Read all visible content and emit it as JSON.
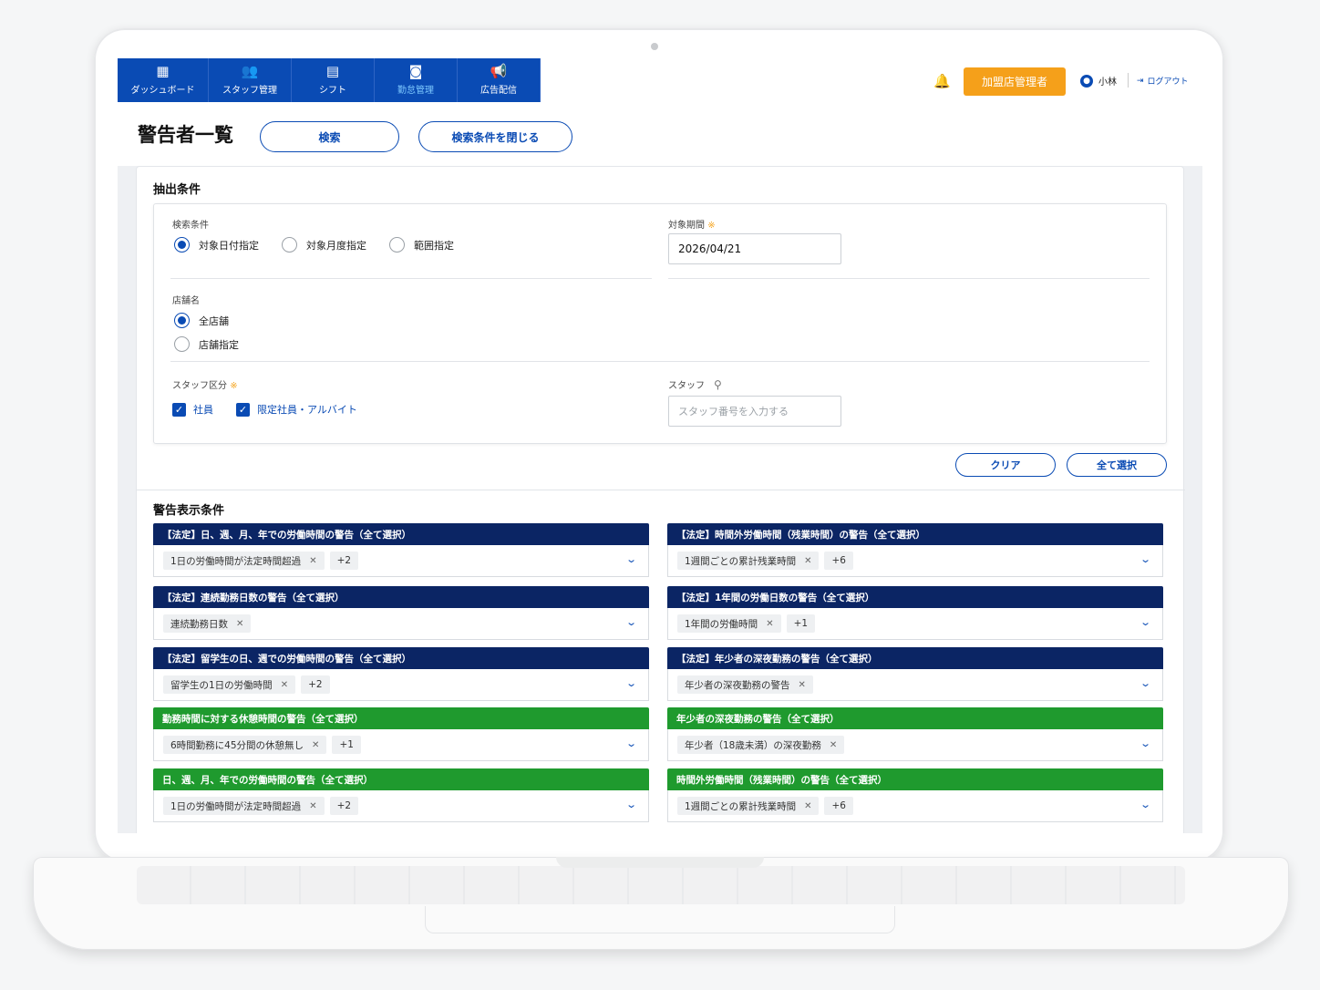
{
  "nav": {
    "items": [
      {
        "label": "ダッシュボード",
        "icon": "dashboard-icon",
        "glyph": "▦"
      },
      {
        "label": "スタッフ管理",
        "icon": "users-icon",
        "glyph": "👥"
      },
      {
        "label": "シフト",
        "icon": "document-icon",
        "glyph": "▤"
      },
      {
        "label": "勤怠管理",
        "icon": "attendance-icon",
        "glyph": "◙",
        "active": true
      },
      {
        "label": "広告配信",
        "icon": "megaphone-icon",
        "glyph": "📢"
      }
    ],
    "role_button": "加盟店管理者",
    "user_name": "小林",
    "logout_label": "ログアウト"
  },
  "page": {
    "title": "警告者一覧",
    "search_button": "検索",
    "close_conditions_button": "検索条件を閉じる"
  },
  "extract": {
    "title": "抽出条件",
    "search_condition_label": "検索条件",
    "search_options": [
      "対象日付指定",
      "対象月度指定",
      "範囲指定"
    ],
    "selected_search_option": "対象日付指定",
    "period_label": "対象期間",
    "required_mark": "※",
    "period_value": "2026/04/21",
    "store_label": "店舗名",
    "store_options": [
      "全店舗",
      "店舗指定"
    ],
    "selected_store_option": "全店舗",
    "staff_type_label": "スタッフ区分",
    "staff_types": [
      "社員",
      "限定社員・アルバイト"
    ],
    "staff_label": "スタッフ",
    "staff_placeholder": "スタッフ番号を入力する",
    "clear_button": "クリア",
    "select_all_button": "全て選択"
  },
  "warnings": {
    "title": "警告表示条件",
    "cards": [
      {
        "header": "【法定】日、週、月、年での労働時間の警告（全て選択）",
        "color": "#0b2564",
        "chip": "1日の労働時間が法定時間超過",
        "more": "+2"
      },
      {
        "header": "【法定】時間外労働時間（残業時間）の警告（全て選択）",
        "color": "#0b2564",
        "chip": "1週間ごとの累計残業時間",
        "more": "+6"
      },
      {
        "header": "【法定】連続勤務日数の警告（全て選択）",
        "color": "#0b2564",
        "chip": "連続勤務日数",
        "more": ""
      },
      {
        "header": "【法定】1年間の労働日数の警告（全て選択）",
        "color": "#0b2564",
        "chip": "1年間の労働時間",
        "more": "+1"
      },
      {
        "header": "【法定】留学生の日、週での労働時間の警告（全て選択）",
        "color": "#0b2564",
        "chip": "留学生の1日の労働時間",
        "more": "+2"
      },
      {
        "header": "【法定】年少者の深夜勤務の警告（全て選択）",
        "color": "#0b2564",
        "chip": "年少者の深夜勤務の警告",
        "more": ""
      },
      {
        "header": "勤務時間に対する休憩時間の警告（全て選択）",
        "color": "#1f9a2e",
        "chip": "6時間勤務に45分間の休憩無し",
        "more": "+1"
      },
      {
        "header": "年少者の深夜勤務の警告（全て選択）",
        "color": "#1f9a2e",
        "chip": "年少者（18歳未満）の深夜勤務",
        "more": ""
      },
      {
        "header": "日、週、月、年での労働時間の警告（全て選択）",
        "color": "#1f9a2e",
        "chip": "1日の労働時間が法定時間超過",
        "more": "+2"
      },
      {
        "header": "時間外労働時間（残業時間）の警告（全て選択）",
        "color": "#1f9a2e",
        "chip": "1週間ごとの累計残業時間",
        "more": "+6"
      }
    ]
  }
}
